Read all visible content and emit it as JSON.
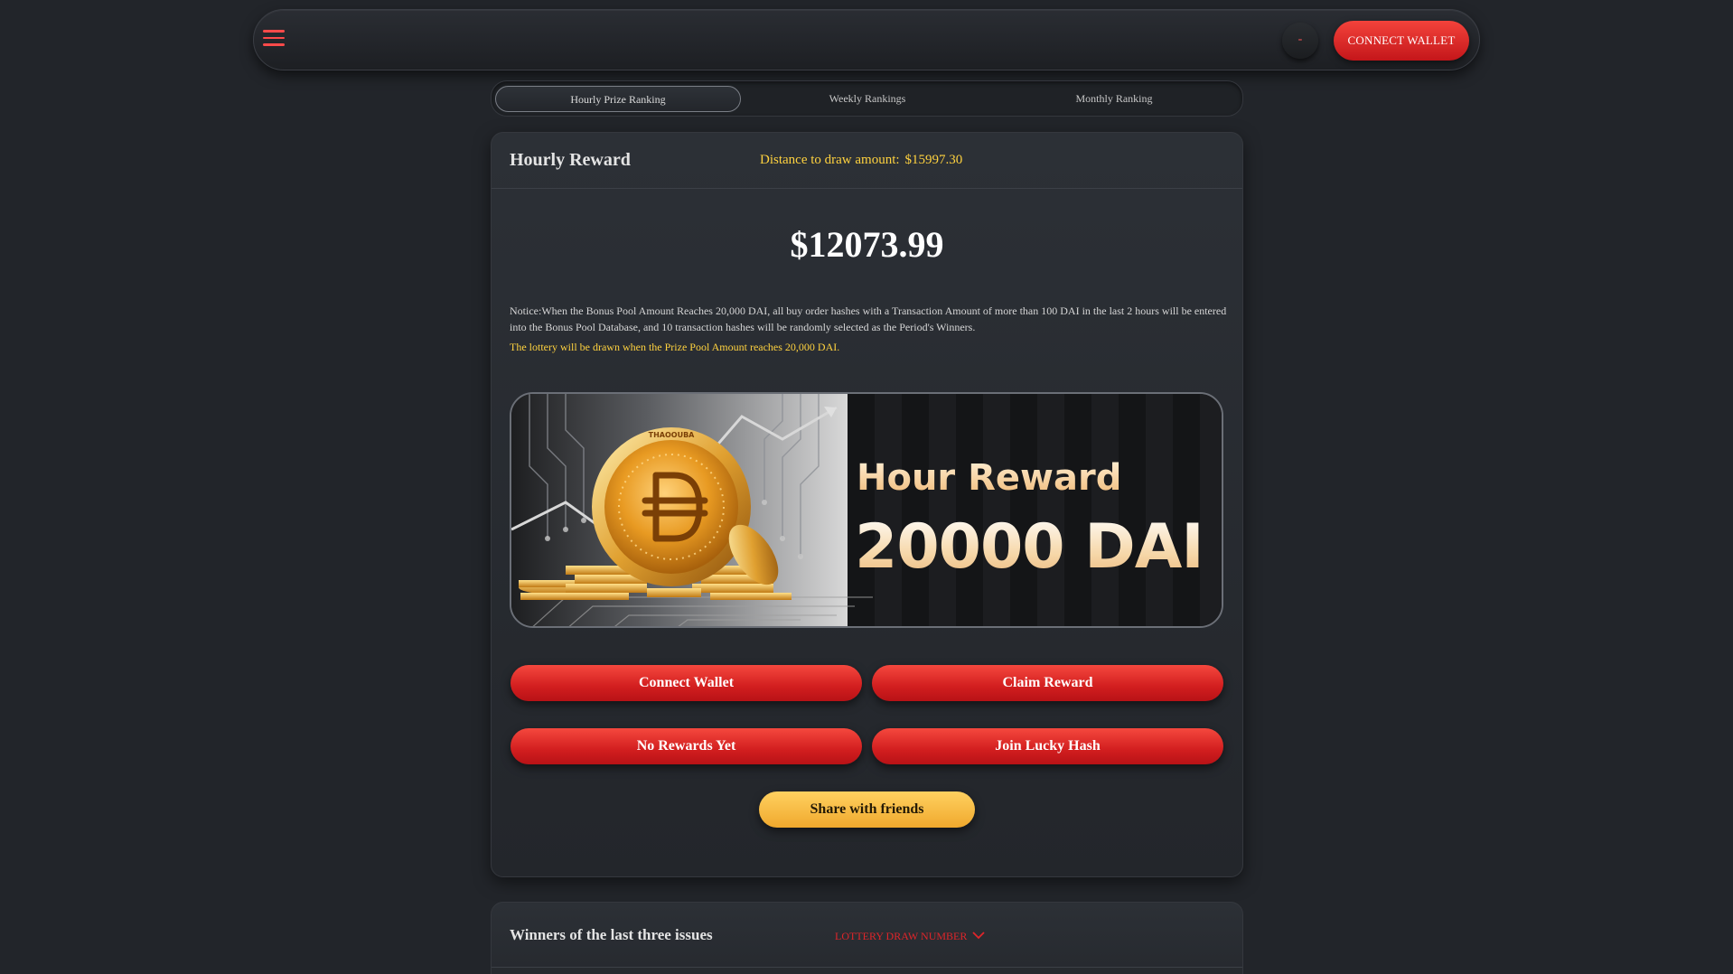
{
  "navbar": {
    "menu_icon": "hamburger-menu-icon",
    "lang_label": "-",
    "connect_label": "CONNECT WALLET"
  },
  "tabs": [
    {
      "label": "Hourly Prize Ranking",
      "active": true
    },
    {
      "label": "Weekly Rankings",
      "active": false
    },
    {
      "label": "Monthly Ranking",
      "active": false
    }
  ],
  "reward": {
    "title": "Hourly Reward",
    "distance_label": "Distance to draw amount:",
    "distance_value": "$15997.30",
    "pool_amount": "$12073.99",
    "notice": "Notice:When the Bonus Pool Amount Reaches 20,000 DAI, all buy order hashes with a Transaction Amount of more than 100 DAI in the last 2 hours will be entered into the Bonus Pool Database, and 10 transaction hashes will be randomly selected as the Period's Winners.",
    "notice_highlight": "The lottery will be drawn when the Prize Pool Amount reaches 20,000 DAI."
  },
  "banner": {
    "line1": "Hour Reward",
    "line2": "20000 DAI",
    "coin_icon": "dai-coin-icon",
    "coin_text": "THAOOUBA"
  },
  "actions": {
    "connect_wallet": "Connect Wallet",
    "claim_reward": "Claim Reward",
    "no_rewards": "No Rewards Yet",
    "join_lucky_hash": "Join Lucky Hash",
    "share": "Share with friends"
  },
  "winners": {
    "title": "Winners of the last three issues",
    "select_label": "LOTTERY DRAW NUMBER"
  },
  "colors": {
    "accent_red": "#e0252a",
    "accent_yellow": "#ffd23f",
    "background": "#22252a"
  }
}
